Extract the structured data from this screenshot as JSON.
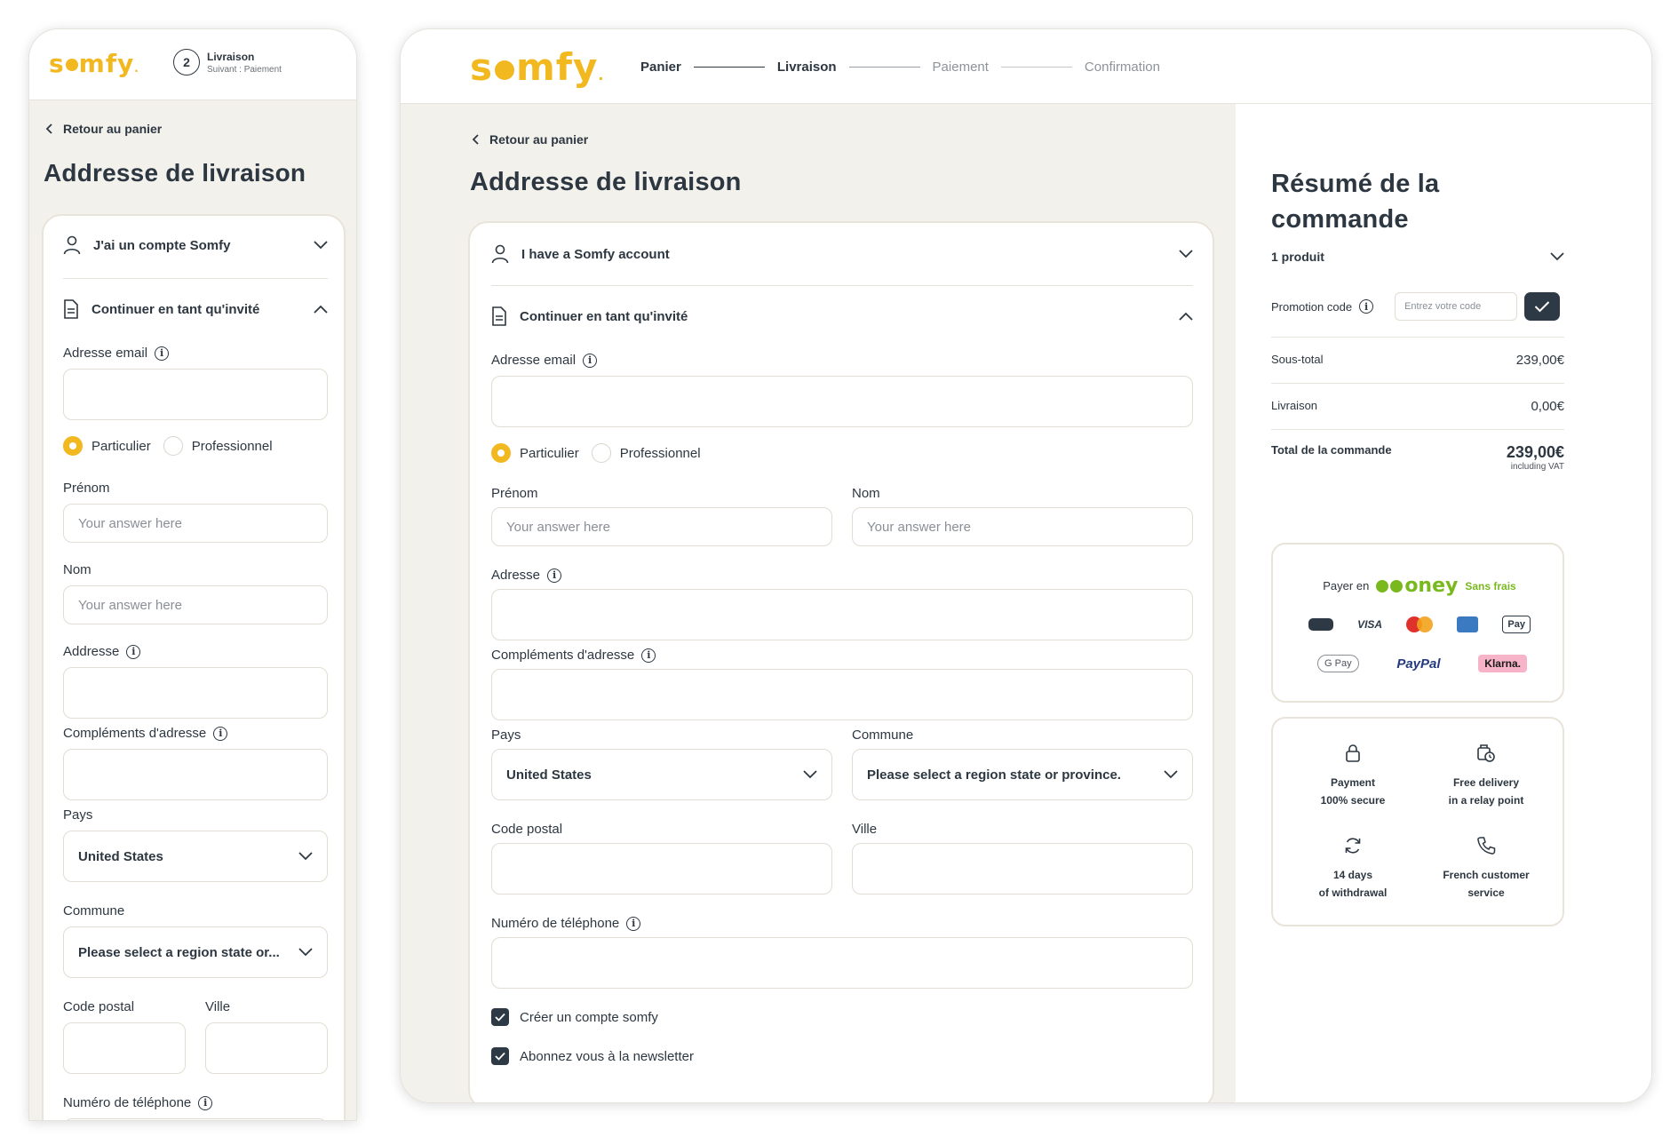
{
  "brand": {
    "logo": "somfy",
    "accent": "#f2b820",
    "dark": "#2d3741"
  },
  "mobile": {
    "step_number": "2",
    "step_title": "Livraison",
    "step_next": "Suivant : Paiement",
    "back_label": "Retour au panier",
    "title": "Addresse de livraison",
    "account_label": "J'ai un compte Somfy",
    "guest_label": "Continuer en tant qu'invité",
    "email_label": "Adresse email",
    "radio_particulier": "Particulier",
    "radio_professionnel": "Professionnel",
    "prenom_label": "Prénom",
    "prenom_placeholder": "Your answer here",
    "nom_label": "Nom",
    "nom_placeholder": "Your answer here",
    "adresse_label": "Addresse",
    "complements_label": "Compléments d'adresse",
    "pays_label": "Pays",
    "pays_value": "United States",
    "commune_label": "Commune",
    "commune_value": "Please select a region state or...",
    "code_postal_label": "Code postal",
    "ville_label": "Ville",
    "telephone_label": "Numéro de téléphone"
  },
  "desktop": {
    "steps": [
      "Panier",
      "Livraison",
      "Paiement",
      "Confirmation"
    ],
    "back_label": "Retour au panier",
    "title": "Addresse de livraison",
    "account_label": "I have a Somfy account",
    "guest_label": "Continuer en tant qu'invité",
    "email_label": "Adresse email",
    "radio_particulier": "Particulier",
    "radio_professionnel": "Professionnel",
    "prenom_label": "Prénom",
    "prenom_placeholder": "Your answer here",
    "nom_label": "Nom",
    "nom_placeholder": "Your answer here",
    "adresse_label": "Adresse",
    "complements_label": "Compléments d'adresse",
    "pays_label": "Pays",
    "pays_value": "United States",
    "commune_label": "Commune",
    "commune_value": "Please select a region state or province.",
    "code_postal_label": "Code postal",
    "ville_label": "Ville",
    "telephone_label": "Numéro de téléphone",
    "create_account_label": "Créer un compte somfy",
    "newsletter_label": "Abonnez vous à la newsletter"
  },
  "summary": {
    "title": "Résumé de la commande",
    "products": "1 produit",
    "promo_label": "Promotion code",
    "promo_placeholder": "Entrez votre code",
    "subtotal_label": "Sous-total",
    "subtotal_value": "239,00€",
    "shipping_label": "Livraison",
    "shipping_value": "0,00€",
    "total_label": "Total de la commande",
    "total_value": "239,00€",
    "total_note": "including VAT",
    "oney_prefix": "Payer en",
    "oney_brand": "oney",
    "oney_suffix": "Sans frais",
    "payment_methods": [
      "CB",
      "VISA",
      "Mastercard",
      "American Express",
      "Apple Pay",
      "G Pay",
      "PayPal",
      "Klarna."
    ],
    "features": [
      {
        "line1": "Payment",
        "line2": "100% secure"
      },
      {
        "line1": "Free delivery",
        "line2": "in a relay point"
      },
      {
        "line1": "14 days",
        "line2": "of withdrawal"
      },
      {
        "line1": "French customer",
        "line2": "service"
      }
    ]
  }
}
